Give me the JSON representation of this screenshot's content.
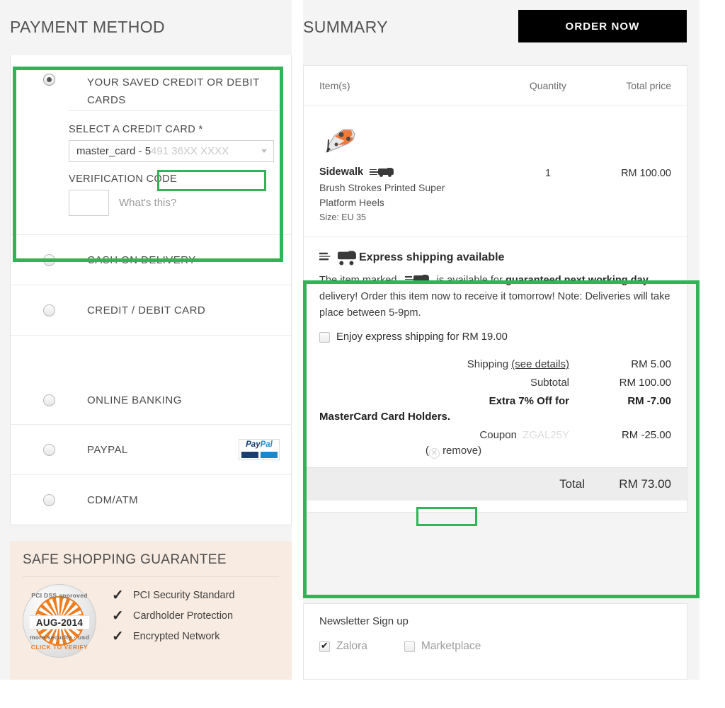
{
  "left": {
    "heading": "PAYMENT METHOD",
    "methods": [
      {
        "id": "saved-cards",
        "label": "YOUR SAVED CREDIT OR DEBIT CARDS",
        "selected": true
      },
      {
        "id": "cash-on-delivery",
        "label": "CASH ON DELIVERY",
        "selected": false
      },
      {
        "id": "credit-debit-card",
        "label": "CREDIT / DEBIT CARD",
        "selected": false
      },
      {
        "id": "online-banking",
        "label": "ONLINE BANKING",
        "selected": false
      },
      {
        "id": "paypal",
        "label": "PAYPAL",
        "selected": false,
        "logo": "paypal-logo"
      },
      {
        "id": "cdm-atm",
        "label": "CDM/ATM",
        "selected": false
      }
    ],
    "saved_card_form": {
      "select_label": "SELECT A CREDIT CARD *",
      "selected_card_visible": "master_card - 5",
      "selected_card_masked": "491 36XX XXXX",
      "cvv_label": "VERIFICATION CODE",
      "cvv_value": "",
      "whats_this": "What's this?"
    },
    "safe_shopping": {
      "heading": "SAFE SHOPPING GUARANTEE",
      "badge": {
        "top_text": "PCI DSS approved",
        "date": "AUG-2014",
        "bottom_text": "more security · usd",
        "verify_text": "CLICK TO VERIFY"
      },
      "items": [
        "PCI Security Standard",
        "Cardholder Protection",
        "Encrypted Network"
      ]
    }
  },
  "right": {
    "heading": "SUMMARY",
    "order_now_label": "ORDER NOW",
    "table_headers": {
      "item": "Item(s)",
      "quantity": "Quantity",
      "total_price": "Total price"
    },
    "items": [
      {
        "brand": "Sidewalk",
        "name": "Brush Strokes Printed Super Platform Heels",
        "size": "Size: EU 35",
        "quantity": "1",
        "total": "RM 100.00",
        "express_badge": "truck-icon"
      }
    ],
    "express": {
      "title": "Express shipping available",
      "text_part1": "The item marked",
      "text_part2": "is available for",
      "text_bold1": "guaranteed next working day",
      "text_part3": "delivery! Order this item now to receive it tomorrow! Note: Deliveries will take place between 5-9pm.",
      "option_label": "Enjoy express shipping for RM 19.00",
      "option_checked": false
    },
    "totals": {
      "shipping_label": "Shipping",
      "shipping_link": "(see details)",
      "shipping_value": "RM 5.00",
      "subtotal_label": "Subtotal",
      "subtotal_value": "RM 100.00",
      "discount_label": "Extra 7% Off for",
      "discount_label_line2": "MasterCard Card Holders.",
      "discount_value": "RM -7.00",
      "coupon_label": "Coupon",
      "coupon_code": "ZGAL25Y",
      "coupon_value": "RM -25.00",
      "remove_label": "remove",
      "total_label": "Total",
      "total_value": "RM 73.00"
    },
    "newsletter": {
      "title": "Newsletter Sign up",
      "options": [
        {
          "label": "Zalora",
          "checked": true
        },
        {
          "label": "Marketplace",
          "checked": false
        }
      ]
    }
  },
  "annotations": {
    "highlight_color": "#2fb457",
    "boxes": [
      "saved-cards-panel",
      "card-number-masked",
      "express-shipping-and-totals",
      "coupon-code-field"
    ]
  }
}
